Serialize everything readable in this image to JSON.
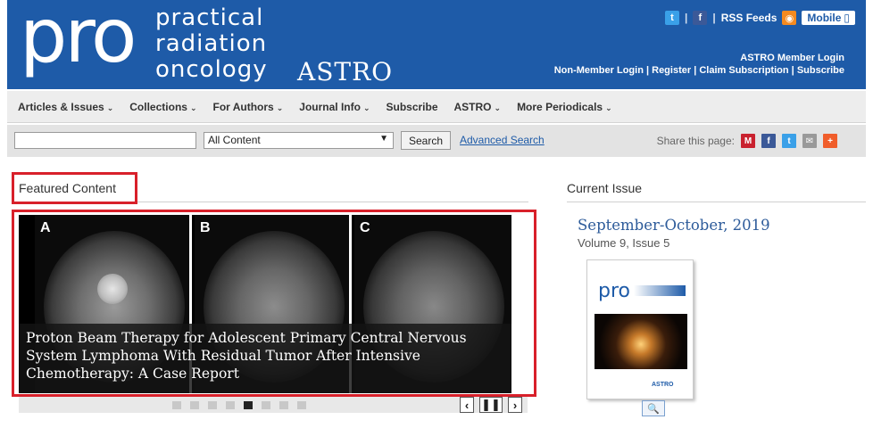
{
  "header": {
    "logo_main": "pro",
    "logo_lines": [
      "practical",
      "radiation",
      "oncology"
    ],
    "logo_org": "ASTRO",
    "twitter_icon": "twitter-icon",
    "facebook_icon": "facebook-icon",
    "rss_label": "RSS Feeds",
    "rss_icon": "rss-icon",
    "mobile_label": "Mobile",
    "member_login": "ASTRO Member Login",
    "non_member_login": "Non-Member Login",
    "register": "Register",
    "claim_subscription": "Claim Subscription",
    "subscribe": "Subscribe",
    "brand_color": "#1e5ba8"
  },
  "nav": {
    "items": [
      {
        "label": "Articles & Issues",
        "chevron": true
      },
      {
        "label": "Collections",
        "chevron": true
      },
      {
        "label": "For Authors",
        "chevron": true
      },
      {
        "label": "Journal Info",
        "chevron": true
      },
      {
        "label": "Subscribe",
        "chevron": false
      },
      {
        "label": "ASTRO",
        "chevron": true
      },
      {
        "label": "More Periodicals",
        "chevron": true
      }
    ]
  },
  "search": {
    "query": "",
    "scope_selected": "All Content",
    "button_label": "Search",
    "advanced_label": "Advanced Search",
    "share_label": "Share this page:"
  },
  "featured": {
    "section_title": "Featured Content",
    "panels": [
      "A",
      "B",
      "C"
    ],
    "caption": "Proton Beam Therapy for Adolescent Primary Central Nervous System Lymphoma With Residual Tumor After Intensive Chemotherapy: A Case Report",
    "slide_count": 8,
    "active_slide": 5,
    "highlight_color": "#d8202a"
  },
  "current_issue": {
    "section_title": "Current Issue",
    "date": "September-October, 2019",
    "volume": "Volume 9, Issue 5",
    "cover_title": "pro",
    "cover_org": "ASTRO"
  }
}
